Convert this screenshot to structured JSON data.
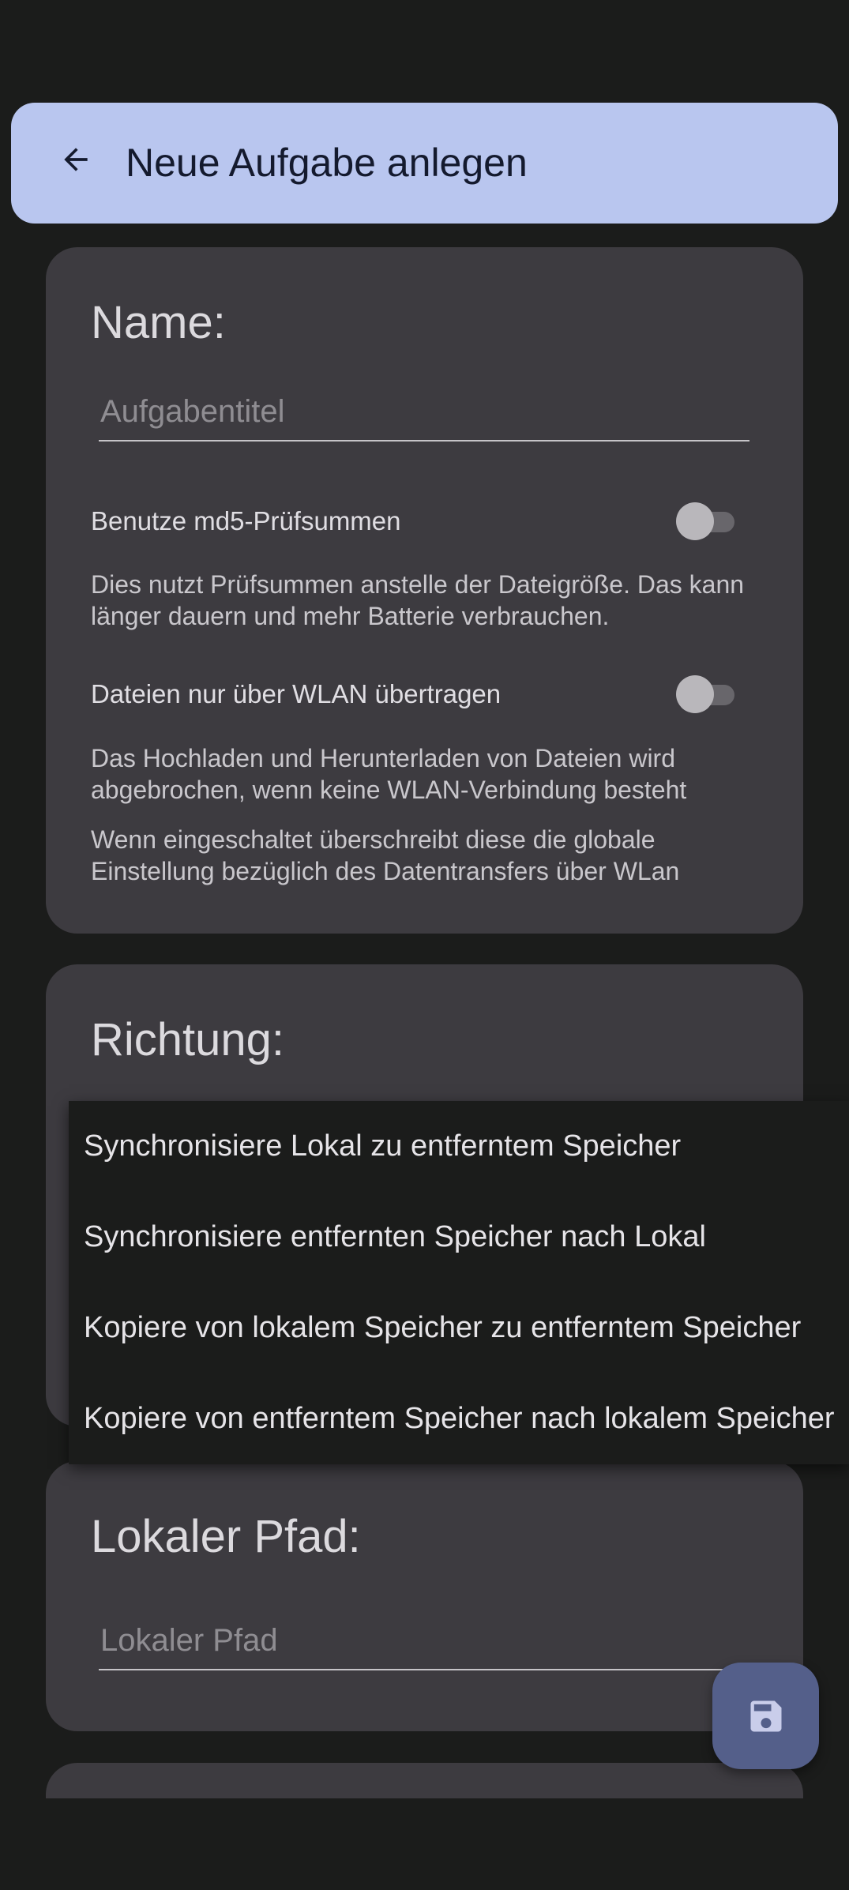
{
  "app_bar": {
    "title": "Neue Aufgabe anlegen",
    "back_icon": "arrow-left-icon"
  },
  "name_card": {
    "title": "Name:",
    "name_input": {
      "value": "",
      "placeholder": "Aufgabentitel"
    },
    "md5_switch": {
      "label": "Benutze md5-Prüfsummen",
      "checked": false,
      "description": "Dies nutzt Prüfsummen anstelle der Dateigröße. Das kann länger dauern und mehr Batterie verbrauchen."
    },
    "wifi_switch": {
      "label": "Dateien nur über WLAN übertragen",
      "checked": false,
      "description": "Das Hochladen und Herunterladen von Dateien wird abgebrochen, wenn keine WLAN-Verbindung besteht",
      "note": "Wenn eingeschaltet überschreibt diese die globale Einstellung bezüglich des Datentransfers über WLan"
    }
  },
  "direction_card": {
    "title": "Richtung:",
    "options": [
      "Synchronisiere Lokal zu entferntem Speicher",
      "Synchronisiere entfernten Speicher nach Lokal",
      "Kopiere von lokalem Speicher zu entferntem Speicher",
      "Kopiere von entferntem Speicher nach lokalem Speicher"
    ]
  },
  "local_path_card": {
    "title": "Lokaler Pfad:",
    "path_input": {
      "value": "",
      "placeholder": "Lokaler Pfad"
    }
  },
  "fab": {
    "icon": "save-icon"
  },
  "colors": {
    "background": "#1b1c1b",
    "app_bar": "#b9c6ef",
    "card": "#3d3b40",
    "fab": "#545f8a"
  }
}
